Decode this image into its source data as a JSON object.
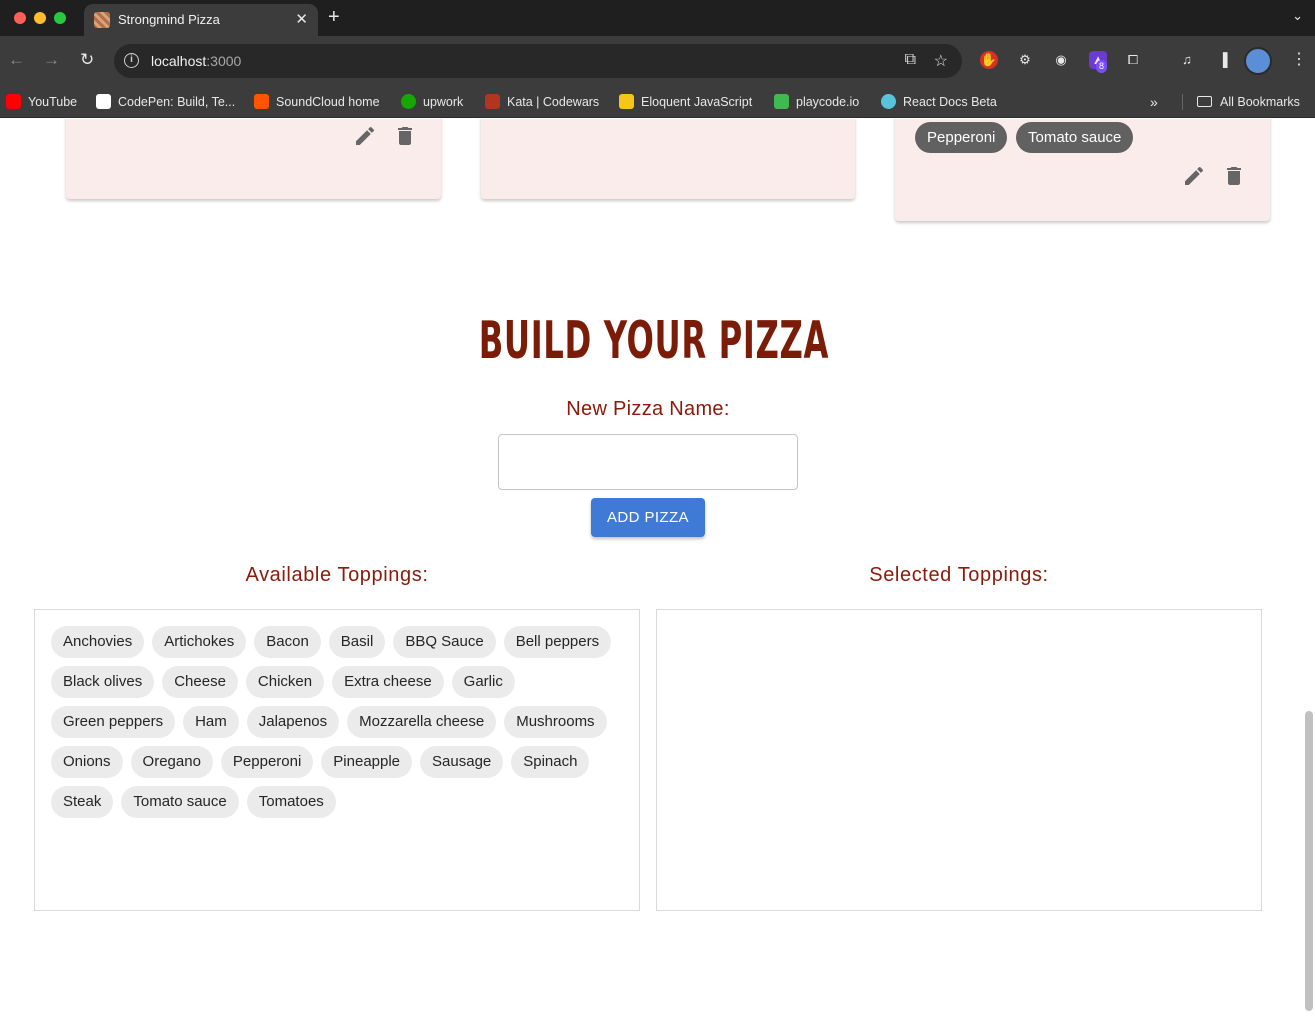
{
  "browser": {
    "tab_title": "Strongmind Pizza",
    "url_host": "localhost",
    "url_port": ":3000",
    "extension_badge": "8",
    "bookmarks": [
      {
        "label": "YouTube",
        "icon": "youtube-icon",
        "color": "#ff0000"
      },
      {
        "label": "CodePen: Build, Te...",
        "icon": "codepen-icon",
        "color": "#ffffff"
      },
      {
        "label": "SoundCloud home",
        "icon": "soundcloud-icon",
        "color": "#ff5500"
      },
      {
        "label": "upwork",
        "icon": "upwork-icon",
        "color": "#14a800"
      },
      {
        "label": "Kata | Codewars",
        "icon": "codewars-icon",
        "color": "#b1361e"
      },
      {
        "label": "Eloquent JavaScript",
        "icon": "eloquent-js-icon",
        "color": "#f5c518"
      },
      {
        "label": "playcode.io",
        "icon": "playcode-icon",
        "color": "#3fb950"
      },
      {
        "label": "React Docs Beta",
        "icon": "react-icon",
        "color": "#58c4dc"
      }
    ],
    "all_bookmarks_label": "All Bookmarks"
  },
  "pizza_cards": [
    {
      "toppings": []
    },
    {
      "toppings": []
    },
    {
      "toppings": [
        "Pepperoni",
        "Tomato sauce"
      ]
    }
  ],
  "builder": {
    "title": "BUILD YOUR PIZZA",
    "name_label": "New Pizza Name:",
    "name_value": "",
    "add_button_label": "ADD PIZZA",
    "available_label": "Available Toppings:",
    "selected_label": "Selected Toppings:",
    "available_toppings": [
      "Anchovies",
      "Artichokes",
      "Bacon",
      "Basil",
      "BBQ Sauce",
      "Bell peppers",
      "Black olives",
      "Cheese",
      "Chicken",
      "Extra cheese",
      "Garlic",
      "Green peppers",
      "Ham",
      "Jalapenos",
      "Mozzarella cheese",
      "Mushrooms",
      "Onions",
      "Oregano",
      "Pepperoni",
      "Pineapple",
      "Sausage",
      "Spinach",
      "Steak",
      "Tomato sauce",
      "Tomatoes"
    ],
    "selected_toppings": []
  },
  "colors": {
    "accent_red": "#8b1a0a",
    "button_blue": "#3f7ad6",
    "card_background": "#fbecec"
  }
}
